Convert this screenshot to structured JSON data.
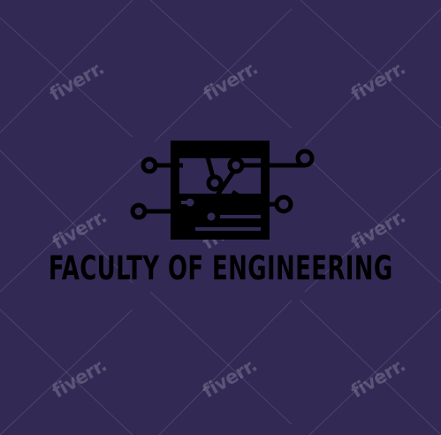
{
  "logo": {
    "title": "FACULTY OF ENGINEERING",
    "icon": "circuit-chip-icon",
    "text_color": "#000000"
  },
  "background_color": "#322a55",
  "watermark": {
    "text": "fiverr."
  }
}
